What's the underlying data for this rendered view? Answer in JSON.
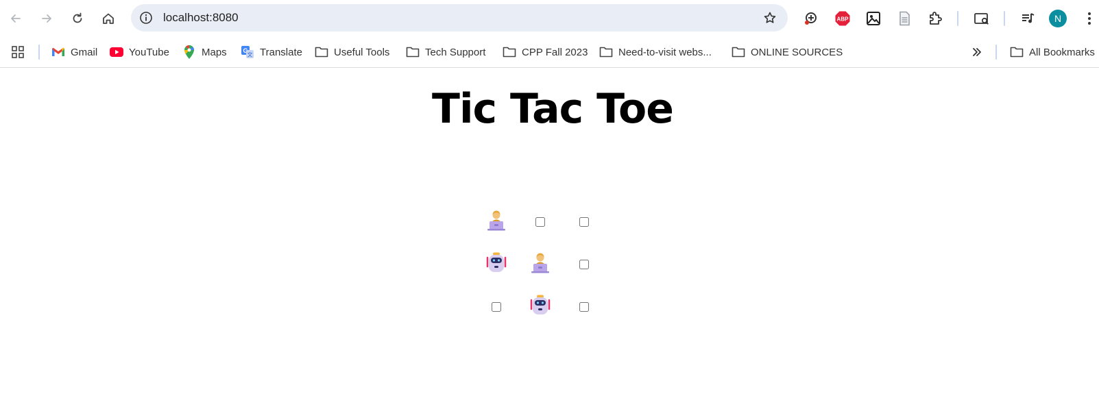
{
  "browser": {
    "url": "localhost:8080",
    "profile_initial": "N",
    "avatar_color": "#0b8fa0"
  },
  "bookmarks": [
    {
      "label": "Gmail",
      "icon": "gmail-icon"
    },
    {
      "label": "YouTube",
      "icon": "youtube-icon"
    },
    {
      "label": "Maps",
      "icon": "maps-icon"
    },
    {
      "label": "Translate",
      "icon": "translate-icon"
    },
    {
      "label": "Useful Tools",
      "icon": "folder-icon"
    },
    {
      "label": "Tech Support",
      "icon": "folder-icon"
    },
    {
      "label": "CPP Fall 2023",
      "icon": "folder-icon"
    },
    {
      "label": "Need-to-visit webs...",
      "icon": "folder-icon"
    },
    {
      "label": "ONLINE SOURCES",
      "icon": "folder-icon"
    }
  ],
  "all_bookmarks_label": "All Bookmarks",
  "page": {
    "title": "Tic Tac Toe"
  },
  "board": [
    [
      "human",
      "empty",
      "empty"
    ],
    [
      "robot",
      "human",
      "empty"
    ],
    [
      "empty",
      "robot",
      "empty"
    ]
  ]
}
